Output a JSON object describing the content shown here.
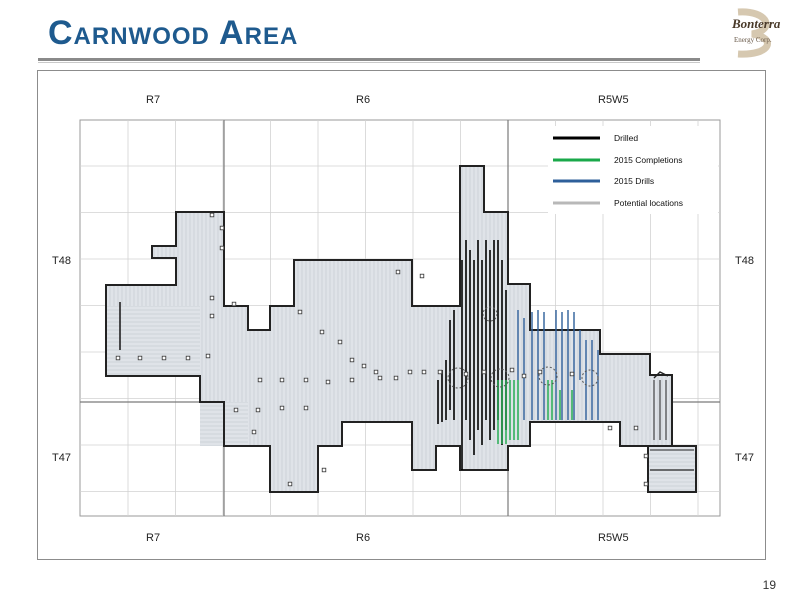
{
  "slide": {
    "title": "Carnwood Area",
    "page_number": "19"
  },
  "logo": {
    "line1": "Bonterra",
    "line2": "Energy Corp."
  },
  "map": {
    "range_labels_top": [
      "R7",
      "R6",
      "R5W5"
    ],
    "range_labels_bottom": [
      "R7",
      "R6",
      "R5W5"
    ],
    "township_labels_left": [
      "T48",
      "T47"
    ],
    "township_labels_right": [
      "T48",
      "T47"
    ],
    "legend": [
      {
        "label": "Drilled",
        "color": "#000000"
      },
      {
        "label": "2015 Completions",
        "color": "#1aa84a"
      },
      {
        "label": "2015 Drills",
        "color": "#2e5f9a"
      },
      {
        "label": "Potential  locations",
        "color": "#b8b8b8"
      }
    ],
    "colors": {
      "land_fill": "#dfe3e8",
      "grid": "#c8c8c8",
      "boundary": "#222222"
    }
  }
}
